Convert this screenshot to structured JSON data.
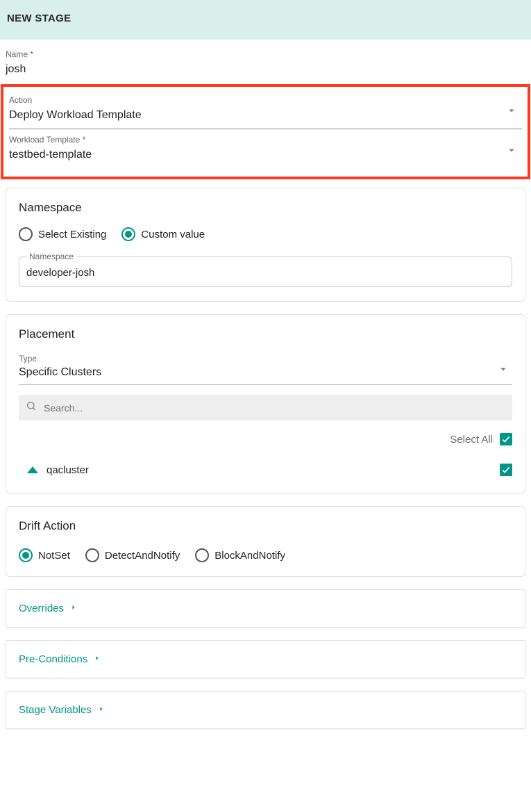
{
  "banner": {
    "title": "NEW STAGE"
  },
  "form": {
    "name": {
      "label": "Name *",
      "value": "josh"
    },
    "action": {
      "label": "Action",
      "value": "Deploy Workload Template"
    },
    "workload_template": {
      "label": "Workload Template *",
      "value": "testbed-template"
    }
  },
  "namespace": {
    "title": "Namespace",
    "options": {
      "existing": "Select Existing",
      "custom": "Custom value"
    },
    "selected": "custom",
    "field_label": "Namespace",
    "value": "developer-josh"
  },
  "placement": {
    "title": "Placement",
    "type_label": "Type",
    "type_value": "Specific Clusters",
    "search_placeholder": "Search...",
    "select_all_label": "Select All",
    "select_all_checked": true,
    "clusters": [
      {
        "name": "qacluster",
        "checked": true
      }
    ]
  },
  "drift": {
    "title": "Drift Action",
    "options": {
      "notset": "NotSet",
      "detect": "DetectAndNotify",
      "block": "BlockAndNotify"
    },
    "selected": "notset"
  },
  "collapsibles": {
    "overrides": "Overrides",
    "preconditions": "Pre-Conditions",
    "stagevars": "Stage Variables"
  }
}
